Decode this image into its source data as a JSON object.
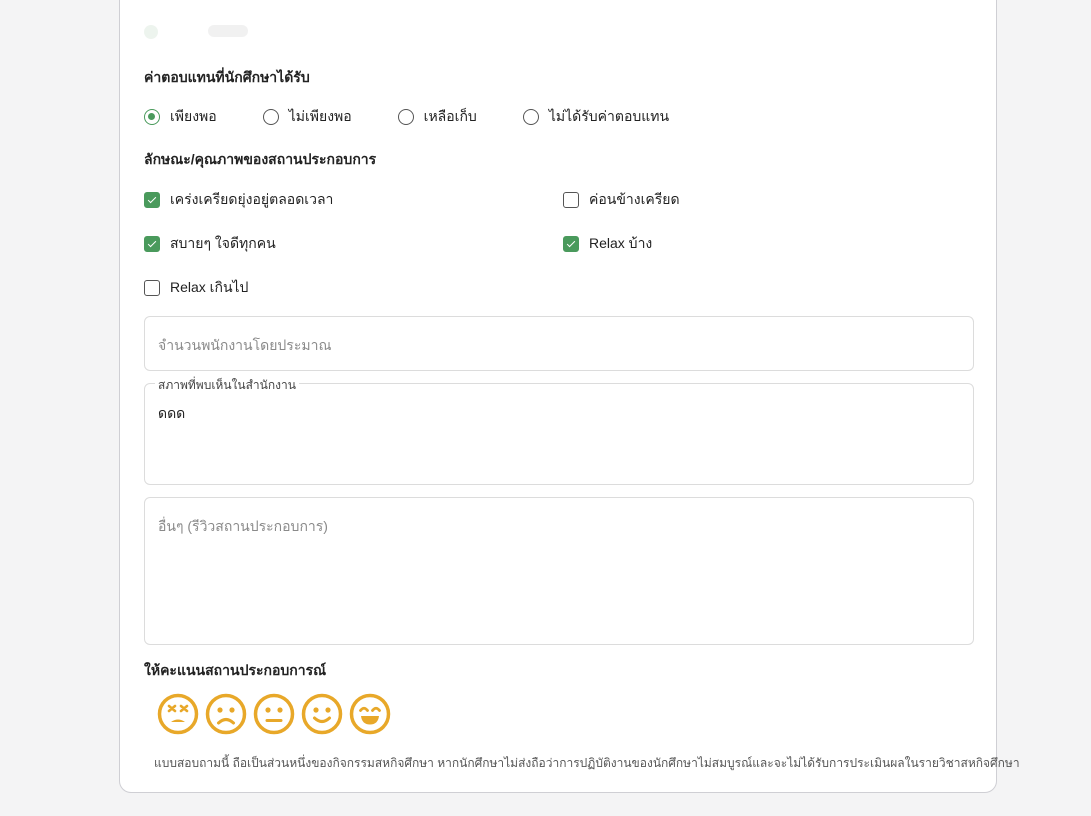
{
  "compensation": {
    "label": "ค่าตอบแทนที่นักศึกษาได้รับ",
    "options": [
      {
        "label": "เพียงพอ",
        "checked": true
      },
      {
        "label": "ไม่เพียงพอ",
        "checked": false
      },
      {
        "label": "เหลือเก็บ",
        "checked": false
      },
      {
        "label": "ไม่ได้รับค่าตอบแทน",
        "checked": false
      }
    ]
  },
  "workplace_character": {
    "label": "ลักษณะ/คุณภาพของสถานประกอบการ",
    "options": [
      {
        "label": "เคร่งเครียดยุ่งอยู่ตลอดเวลา",
        "checked": true
      },
      {
        "label": "ค่อนข้างเครียด",
        "checked": false
      },
      {
        "label": "สบายๆ ใจดีทุกคน",
        "checked": true
      },
      {
        "label": "Relax บ้าง",
        "checked": true
      },
      {
        "label": "Relax เกินไป",
        "checked": false
      }
    ]
  },
  "employee_count": {
    "placeholder": "จำนวนพนักงานโดยประมาณ",
    "value": ""
  },
  "office_condition": {
    "label": "สภาพที่พบเห็นในสำนักงาน",
    "value": "ดดด"
  },
  "other_review": {
    "placeholder": "อื่นๆ (รีวิวสถานประกอบการ)",
    "value": ""
  },
  "rating": {
    "label": "ให้คะแนนสถานประกอบการณ์",
    "icons": [
      "dizzy-face-icon",
      "sad-face-icon",
      "neutral-face-icon",
      "smile-face-icon",
      "grin-face-icon"
    ],
    "color": "#e8a829"
  },
  "footnote": "แบบสอบถามนี้ ถือเป็นส่วนหนึ่งของกิจกรรมสหกิจศึกษา หากนักศึกษาไม่ส่งถือว่าการปฏิบัติงานของนักศึกษาไม่สมบูรณ์และจะไม่ได้รับการประเมินผลในรายวิชาสหกิจศึกษา",
  "accent_color": "#4a9a5c"
}
